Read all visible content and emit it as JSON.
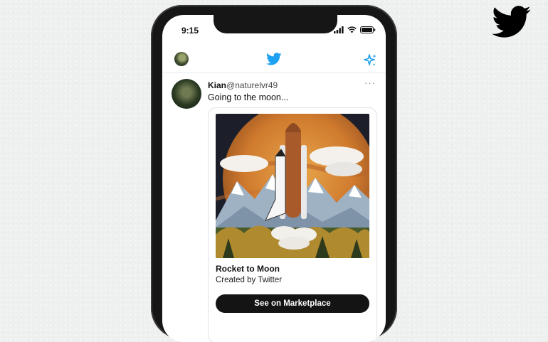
{
  "status_bar": {
    "time": "9:15"
  },
  "tweet": {
    "author_name": "Kian",
    "author_handle": "@naturelvr49",
    "text": "Going to the moon...",
    "more": "···"
  },
  "card": {
    "title": "Rocket to Moon",
    "subtitle": "Created by Twitter",
    "button_label": "See on Marketplace"
  },
  "colors": {
    "twitter_blue": "#1da1f2",
    "button_dark": "#141414",
    "page_background": "#eef0ef"
  },
  "icons": [
    "twitter-bird-icon",
    "sparkle-icon",
    "signal-icon",
    "wifi-icon",
    "battery-icon",
    "more-icon"
  ]
}
